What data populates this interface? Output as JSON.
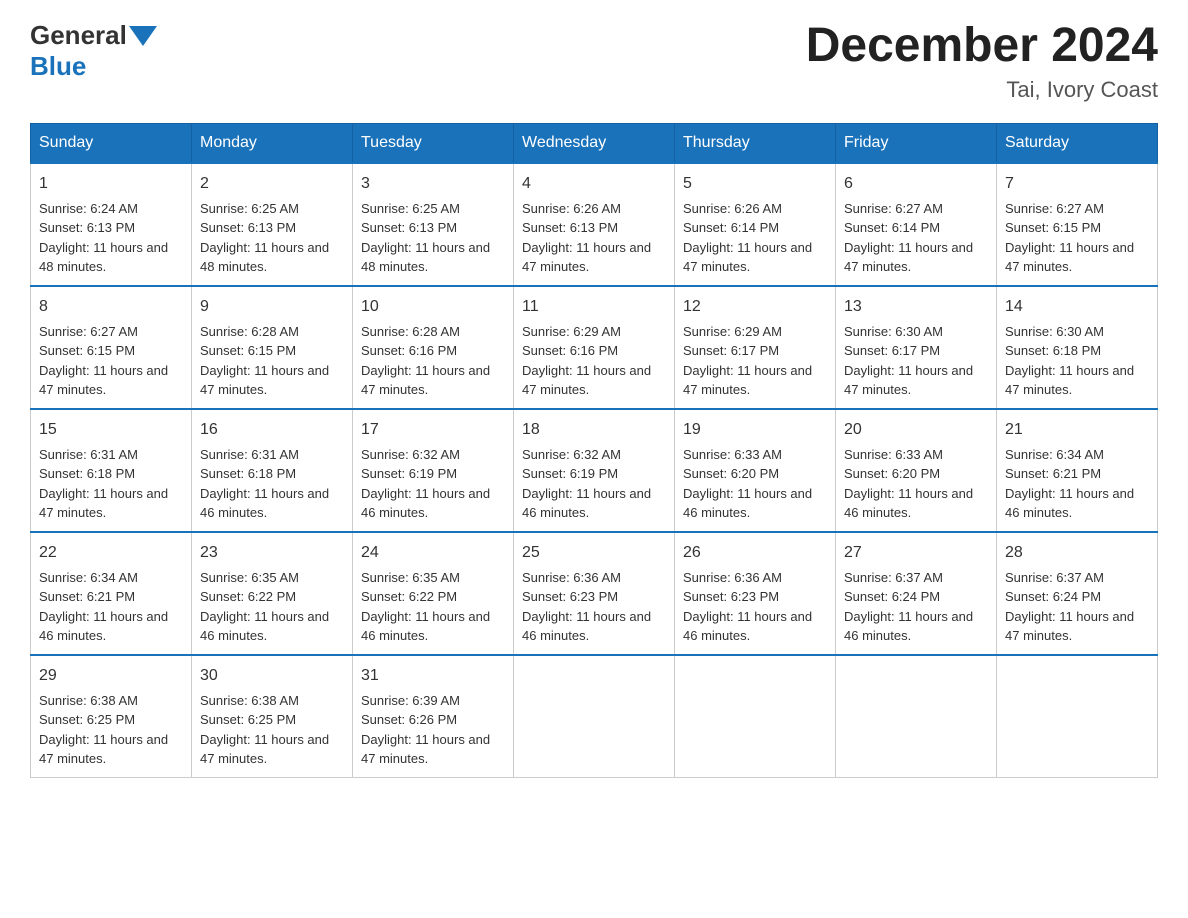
{
  "header": {
    "logo_general": "General",
    "logo_blue": "Blue",
    "month_title": "December 2024",
    "location": "Tai, Ivory Coast"
  },
  "days_of_week": [
    "Sunday",
    "Monday",
    "Tuesday",
    "Wednesday",
    "Thursday",
    "Friday",
    "Saturday"
  ],
  "weeks": [
    [
      {
        "day": "1",
        "sunrise": "6:24 AM",
        "sunset": "6:13 PM",
        "daylight": "11 hours and 48 minutes."
      },
      {
        "day": "2",
        "sunrise": "6:25 AM",
        "sunset": "6:13 PM",
        "daylight": "11 hours and 48 minutes."
      },
      {
        "day": "3",
        "sunrise": "6:25 AM",
        "sunset": "6:13 PM",
        "daylight": "11 hours and 48 minutes."
      },
      {
        "day": "4",
        "sunrise": "6:26 AM",
        "sunset": "6:13 PM",
        "daylight": "11 hours and 47 minutes."
      },
      {
        "day": "5",
        "sunrise": "6:26 AM",
        "sunset": "6:14 PM",
        "daylight": "11 hours and 47 minutes."
      },
      {
        "day": "6",
        "sunrise": "6:27 AM",
        "sunset": "6:14 PM",
        "daylight": "11 hours and 47 minutes."
      },
      {
        "day": "7",
        "sunrise": "6:27 AM",
        "sunset": "6:15 PM",
        "daylight": "11 hours and 47 minutes."
      }
    ],
    [
      {
        "day": "8",
        "sunrise": "6:27 AM",
        "sunset": "6:15 PM",
        "daylight": "11 hours and 47 minutes."
      },
      {
        "day": "9",
        "sunrise": "6:28 AM",
        "sunset": "6:15 PM",
        "daylight": "11 hours and 47 minutes."
      },
      {
        "day": "10",
        "sunrise": "6:28 AM",
        "sunset": "6:16 PM",
        "daylight": "11 hours and 47 minutes."
      },
      {
        "day": "11",
        "sunrise": "6:29 AM",
        "sunset": "6:16 PM",
        "daylight": "11 hours and 47 minutes."
      },
      {
        "day": "12",
        "sunrise": "6:29 AM",
        "sunset": "6:17 PM",
        "daylight": "11 hours and 47 minutes."
      },
      {
        "day": "13",
        "sunrise": "6:30 AM",
        "sunset": "6:17 PM",
        "daylight": "11 hours and 47 minutes."
      },
      {
        "day": "14",
        "sunrise": "6:30 AM",
        "sunset": "6:18 PM",
        "daylight": "11 hours and 47 minutes."
      }
    ],
    [
      {
        "day": "15",
        "sunrise": "6:31 AM",
        "sunset": "6:18 PM",
        "daylight": "11 hours and 47 minutes."
      },
      {
        "day": "16",
        "sunrise": "6:31 AM",
        "sunset": "6:18 PM",
        "daylight": "11 hours and 46 minutes."
      },
      {
        "day": "17",
        "sunrise": "6:32 AM",
        "sunset": "6:19 PM",
        "daylight": "11 hours and 46 minutes."
      },
      {
        "day": "18",
        "sunrise": "6:32 AM",
        "sunset": "6:19 PM",
        "daylight": "11 hours and 46 minutes."
      },
      {
        "day": "19",
        "sunrise": "6:33 AM",
        "sunset": "6:20 PM",
        "daylight": "11 hours and 46 minutes."
      },
      {
        "day": "20",
        "sunrise": "6:33 AM",
        "sunset": "6:20 PM",
        "daylight": "11 hours and 46 minutes."
      },
      {
        "day": "21",
        "sunrise": "6:34 AM",
        "sunset": "6:21 PM",
        "daylight": "11 hours and 46 minutes."
      }
    ],
    [
      {
        "day": "22",
        "sunrise": "6:34 AM",
        "sunset": "6:21 PM",
        "daylight": "11 hours and 46 minutes."
      },
      {
        "day": "23",
        "sunrise": "6:35 AM",
        "sunset": "6:22 PM",
        "daylight": "11 hours and 46 minutes."
      },
      {
        "day": "24",
        "sunrise": "6:35 AM",
        "sunset": "6:22 PM",
        "daylight": "11 hours and 46 minutes."
      },
      {
        "day": "25",
        "sunrise": "6:36 AM",
        "sunset": "6:23 PM",
        "daylight": "11 hours and 46 minutes."
      },
      {
        "day": "26",
        "sunrise": "6:36 AM",
        "sunset": "6:23 PM",
        "daylight": "11 hours and 46 minutes."
      },
      {
        "day": "27",
        "sunrise": "6:37 AM",
        "sunset": "6:24 PM",
        "daylight": "11 hours and 46 minutes."
      },
      {
        "day": "28",
        "sunrise": "6:37 AM",
        "sunset": "6:24 PM",
        "daylight": "11 hours and 47 minutes."
      }
    ],
    [
      {
        "day": "29",
        "sunrise": "6:38 AM",
        "sunset": "6:25 PM",
        "daylight": "11 hours and 47 minutes."
      },
      {
        "day": "30",
        "sunrise": "6:38 AM",
        "sunset": "6:25 PM",
        "daylight": "11 hours and 47 minutes."
      },
      {
        "day": "31",
        "sunrise": "6:39 AM",
        "sunset": "6:26 PM",
        "daylight": "11 hours and 47 minutes."
      },
      null,
      null,
      null,
      null
    ]
  ],
  "cell_labels": {
    "sunrise": "Sunrise: ",
    "sunset": "Sunset: ",
    "daylight": "Daylight: "
  }
}
